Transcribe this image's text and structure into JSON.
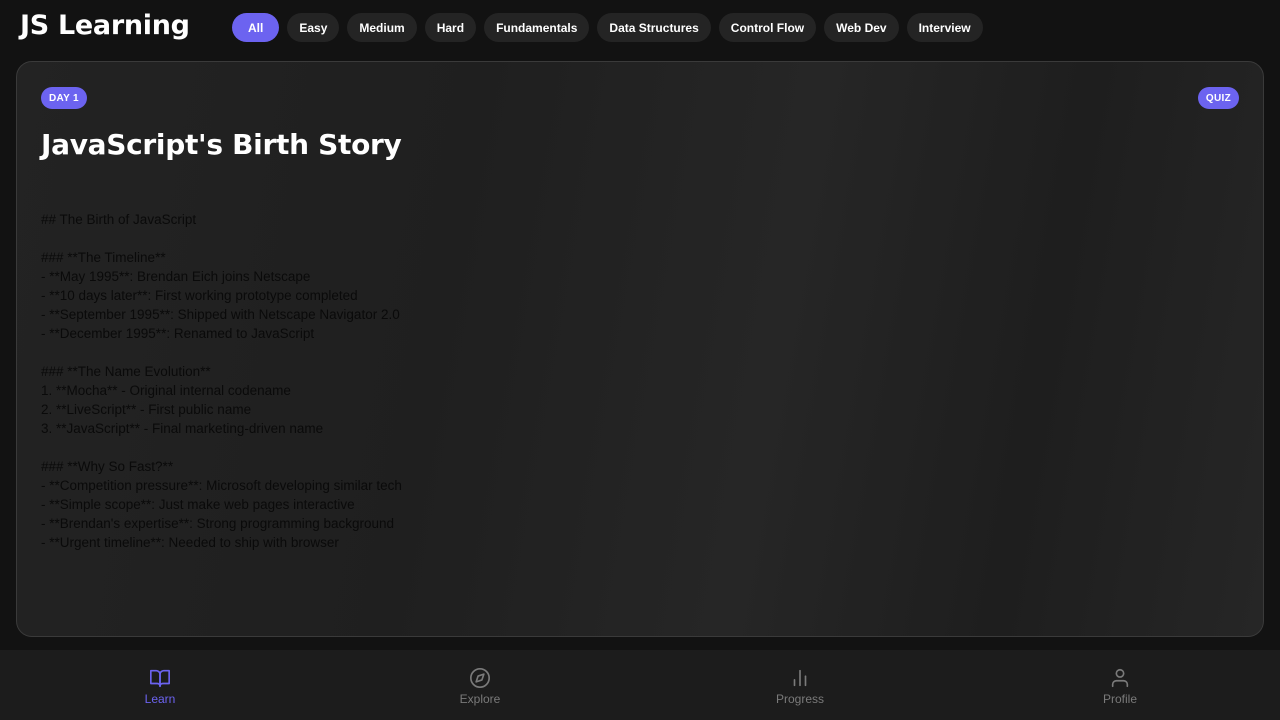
{
  "app": {
    "title": "JS Learning"
  },
  "filters": [
    "All",
    "Easy",
    "Medium",
    "Hard",
    "Fundamentals",
    "Data Structures",
    "Control Flow",
    "Web Dev",
    "Interview"
  ],
  "active_filter": "All",
  "card": {
    "day_badge": "DAY 1",
    "type_badge": "QUIZ",
    "title": "JavaScript's Birth Story",
    "content_lines": [
      "## The Birth of JavaScript",
      "",
      "### **The Timeline**",
      "- **May 1995**: Brendan Eich joins Netscape",
      "- **10 days later**: First working prototype completed",
      "- **September 1995**: Shipped with Netscape Navigator 2.0",
      "- **December 1995**: Renamed to JavaScript",
      "",
      "### **The Name Evolution**",
      "1. **Mocha** - Original internal codename",
      "2. **LiveScript** - First public name",
      "3. **JavaScript** - Final marketing-driven name",
      "",
      "### **Why So Fast?**",
      "- **Competition pressure**: Microsoft developing similar tech",
      "- **Simple scope**: Just make web pages interactive",
      "- **Brendan's expertise**: Strong programming background",
      "- **Urgent timeline**: Needed to ship with browser"
    ]
  },
  "bottom_nav": [
    {
      "label": "Learn",
      "icon": "book-icon",
      "active": true
    },
    {
      "label": "Explore",
      "icon": "compass-icon",
      "active": false
    },
    {
      "label": "Progress",
      "icon": "bar-chart-icon",
      "active": false
    },
    {
      "label": "Profile",
      "icon": "user-icon",
      "active": false
    }
  ],
  "colors": {
    "accent": "#6c63f0",
    "background": "#121212",
    "card": "#222222",
    "inactive": "#7a7a7a"
  }
}
